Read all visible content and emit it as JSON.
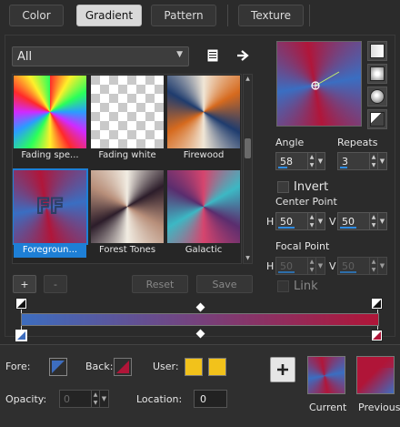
{
  "tabs": [
    {
      "label": "Color",
      "active": false
    },
    {
      "label": "Gradient",
      "active": true
    },
    {
      "label": "Pattern",
      "active": false
    },
    {
      "label": "Texture",
      "active": false
    }
  ],
  "preset_filter": {
    "value": "All"
  },
  "presets": [
    {
      "label": "Fading spe...",
      "selected": false
    },
    {
      "label": "Fading white",
      "selected": false
    },
    {
      "label": "Firewood",
      "selected": false
    },
    {
      "label": "Foregroun...",
      "selected": true
    },
    {
      "label": "Forest Tones",
      "selected": false
    },
    {
      "label": "Galactic",
      "selected": false
    }
  ],
  "buttons": {
    "add": "+",
    "remove": "-",
    "reset": "Reset",
    "save": "Save"
  },
  "controls": {
    "angle_label": "Angle",
    "angle_value": "58",
    "repeats_label": "Repeats",
    "repeats_value": "3",
    "invert_label": "Invert",
    "center_point_label": "Center Point",
    "center_h": "50",
    "center_v": "50",
    "focal_point_label": "Focal Point",
    "focal_h": "50",
    "focal_v": "50",
    "h_label": "H",
    "v_label": "V",
    "link_label": "Link"
  },
  "colors": {
    "fore": "#3d6dbf",
    "back": "#b01538",
    "user1": "#f2c21b",
    "user2": "#f2c21b",
    "accent": "#1e7fd6"
  },
  "editor": {
    "fore_label": "Fore:",
    "back_label": "Back:",
    "user_label": "User:",
    "opacity_label": "Opacity:",
    "opacity_value": "0",
    "location_label": "Location:",
    "location_value": "0"
  },
  "compare": {
    "current_label": "Current",
    "previous_label": "Previous"
  }
}
